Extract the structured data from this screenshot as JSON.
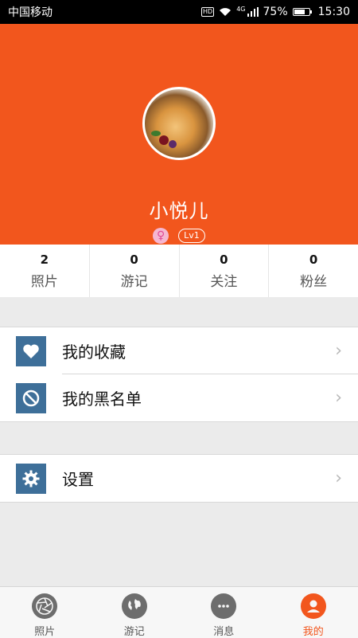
{
  "status_bar": {
    "carrier": "中国移动",
    "hd": "HD",
    "network": "4G",
    "battery": "75%",
    "battery_level": 0.75,
    "time": "15:30"
  },
  "profile": {
    "username": "小悦儿",
    "gender_symbol": "♀",
    "level": "Lv1"
  },
  "stats": [
    {
      "count": "2",
      "label": "照片"
    },
    {
      "count": "0",
      "label": "游记"
    },
    {
      "count": "0",
      "label": "关注"
    },
    {
      "count": "0",
      "label": "粉丝"
    }
  ],
  "menu": {
    "favorites": {
      "label": "我的收藏",
      "icon": "heart-icon"
    },
    "blacklist": {
      "label": "我的黑名单",
      "icon": "block-icon"
    },
    "settings": {
      "label": "设置",
      "icon": "gear-icon"
    }
  },
  "tabs": [
    {
      "label": "照片",
      "icon": "camera-aperture-icon"
    },
    {
      "label": "游记",
      "icon": "globe-icon"
    },
    {
      "label": "消息",
      "icon": "chat-bubble-icon"
    },
    {
      "label": "我的",
      "icon": "user-icon",
      "active": true
    }
  ],
  "colors": {
    "accent": "#f2561d",
    "icon_bg": "#3e6f99",
    "background": "#ebebeb"
  }
}
